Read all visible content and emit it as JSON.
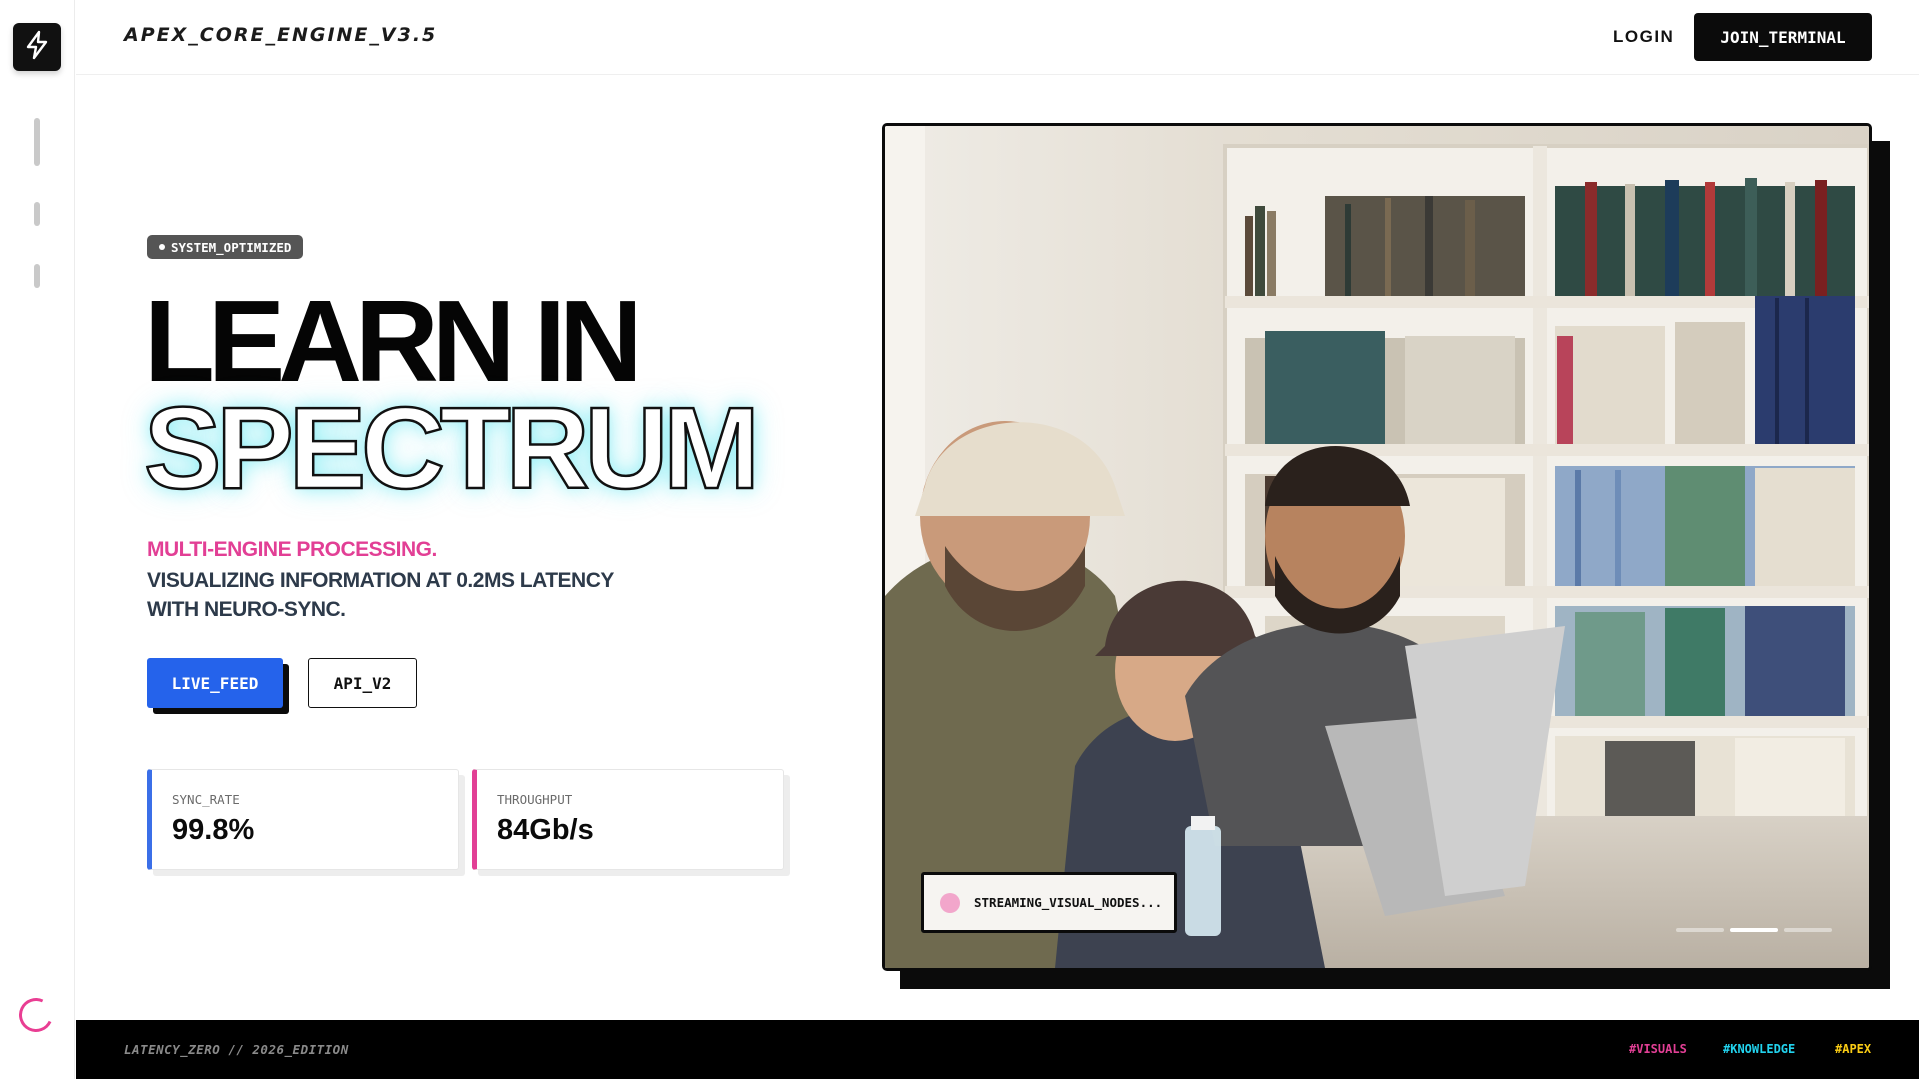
{
  "header": {
    "brand": "APEX_CORE_ENGINE_V3.5",
    "login_label": "LOGIN",
    "join_label": "JOIN_TERMINAL"
  },
  "sidebar": {
    "logo_icon": "lightning-icon",
    "nav_items": [
      "nav-indicator-1",
      "nav-indicator-2",
      "nav-indicator-3"
    ],
    "loader_icon": "loading-spinner-icon"
  },
  "hero": {
    "status_badge": "SYSTEM_OPTIMIZED",
    "title_line1": "LEARN IN",
    "title_line2": "SPECTRUM",
    "subtitle_accent": "MULTI-ENGINE PROCESSING.",
    "subtitle_text": "VISUALIZING INFORMATION AT 0.2MS LATENCY WITH NEURO-SYNC.",
    "primary_button": "LIVE_FEED",
    "secondary_button": "API_V2"
  },
  "stats": [
    {
      "label": "SYNC_RATE",
      "value": "99.8%",
      "accent": "#3b6fe8"
    },
    {
      "label": "THROUGHPUT",
      "value": "84Gb/s",
      "accent": "#e23f95"
    }
  ],
  "media": {
    "stream_status": "STREAMING_VISUAL_NODES...",
    "carousel_count": 3,
    "carousel_active": 2
  },
  "footer": {
    "edition": "LATENCY_ZERO // 2026_EDITION",
    "tags": [
      "#VISUALS",
      "#KNOWLEDGE",
      "#APEX"
    ]
  },
  "colors": {
    "accent_blue": "#2563eb",
    "accent_pink": "#e23f95",
    "accent_cyan": "#22d3ee",
    "accent_yellow": "#facc15"
  }
}
